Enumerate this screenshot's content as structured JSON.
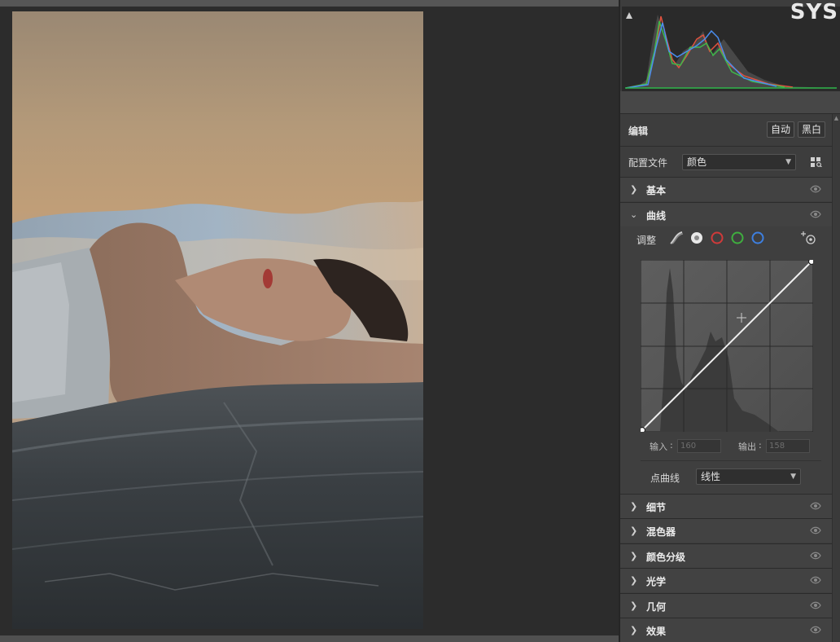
{
  "watermark": "SYS",
  "panel": {
    "edit": {
      "title": "编辑",
      "auto_label": "自动",
      "bw_label": "黑白"
    },
    "profile": {
      "label": "配置文件",
      "value": "颜色"
    },
    "sections_top": [
      {
        "title": "基本",
        "expanded": false
      }
    ],
    "curves": {
      "title": "曲线",
      "expanded": true,
      "adjust_label": "调整",
      "input_label": "输入",
      "input_value": "160",
      "output_label": "输出",
      "output_value": "158",
      "point_curve_label": "点曲线",
      "point_curve_value": "线性",
      "channel_colors": {
        "white": "#e8e8e8",
        "red": "#d03a3a",
        "green": "#3fae3f",
        "blue": "#3d7fe0"
      }
    },
    "sections_bottom": [
      {
        "title": "细节"
      },
      {
        "title": "混色器"
      },
      {
        "title": "颜色分级"
      },
      {
        "title": "光学"
      },
      {
        "title": "几何"
      },
      {
        "title": "效果"
      }
    ]
  },
  "icons": {
    "histogram_clip": "clipping-warning-icon",
    "profile_browser": "profile-browser-grid-icon",
    "curve_parametric": "parametric-curve-icon",
    "curve_target": "targeted-adjustment-icon",
    "visibility": "eye-icon",
    "section_collapsed": "chevron-right-icon",
    "section_expanded": "chevron-down-icon"
  }
}
